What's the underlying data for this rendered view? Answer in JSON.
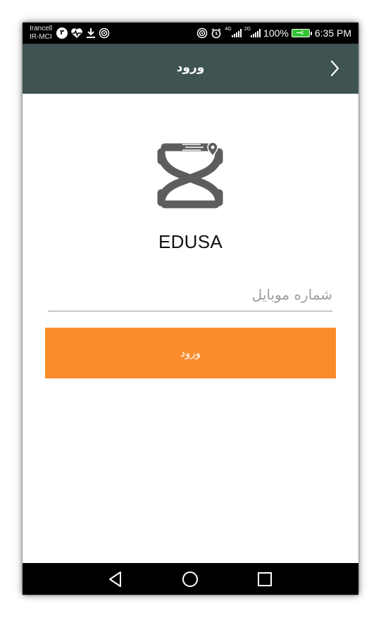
{
  "status_bar": {
    "carrier_line1": "Irancell",
    "carrier_line2": "IR-MCI",
    "notification_badge": "۳",
    "network_4g": "4G",
    "network_2g": "2G",
    "battery_text": "100%",
    "time": "6:35 PM",
    "icons": [
      "notification-count-icon",
      "heart-rate-icon",
      "download-icon",
      "hotspot-icon",
      "hotspot-icon",
      "alarm-icon",
      "signal-icon",
      "signal-icon",
      "battery-icon"
    ]
  },
  "toolbar": {
    "title": "ورود",
    "back_icon": "chevron-right-icon"
  },
  "main": {
    "logo_icon": "edusa-logo-icon",
    "app_name": "EDUSA",
    "phone_placeholder": "شماره موبایل",
    "login_button_label": "ورود"
  },
  "nav_bar": {
    "icons": [
      "back-triangle-icon",
      "home-circle-icon",
      "recents-square-icon"
    ]
  },
  "colors": {
    "toolbar": "#3e5352",
    "accent": "#fb8c2c",
    "logo": "#5d5d5d",
    "status_bar": "#000000",
    "battery": "#35c235"
  }
}
